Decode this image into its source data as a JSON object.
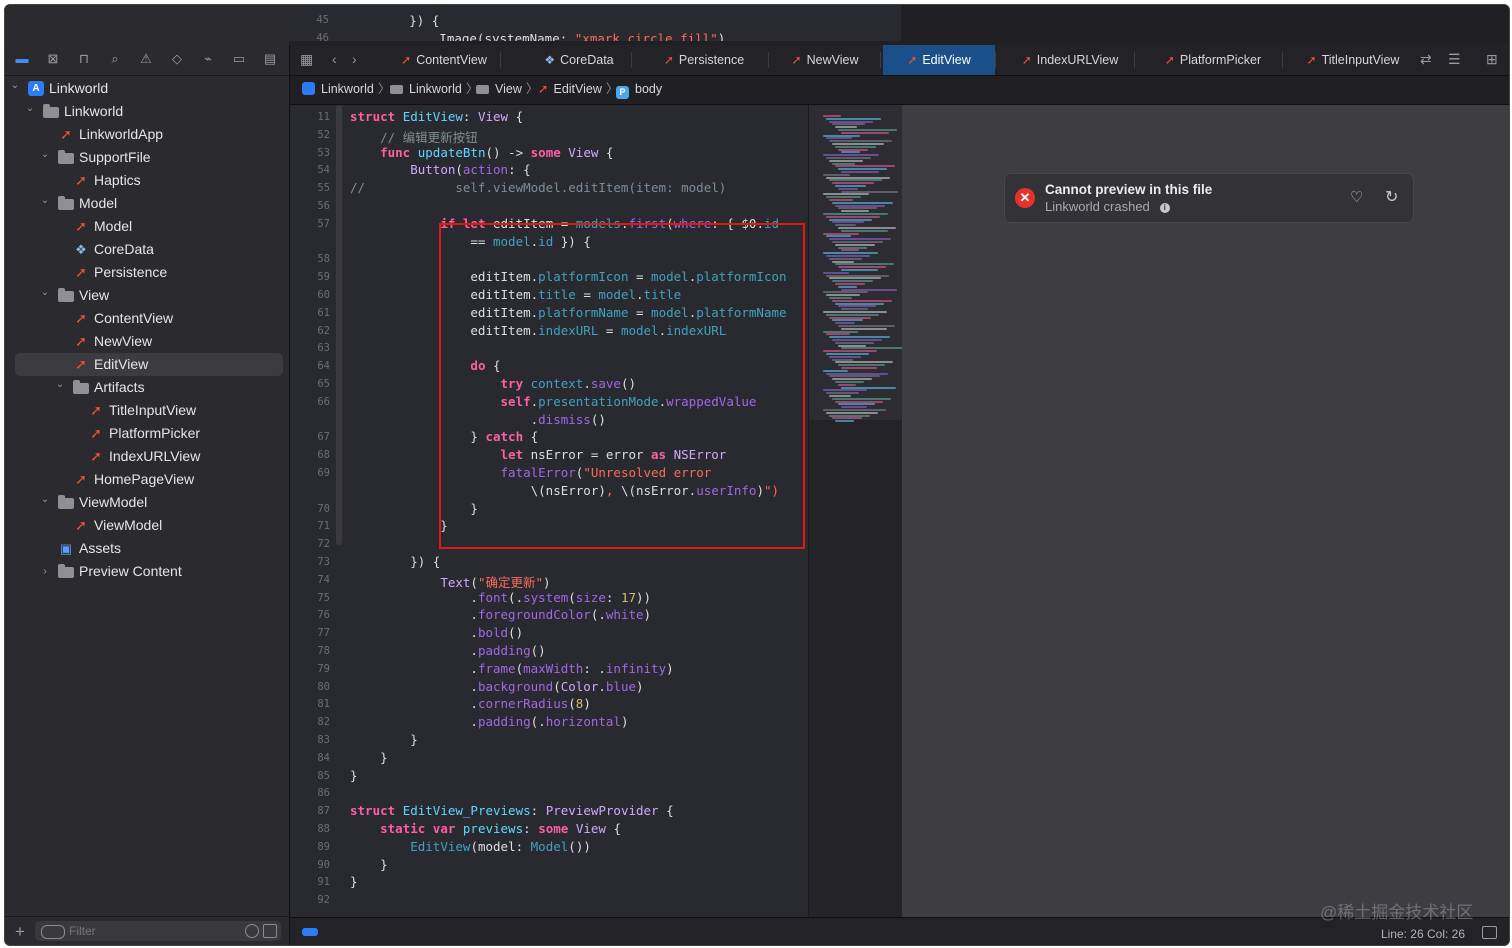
{
  "top_code": {
    "lines": [
      {
        "n": "45",
        "t": "        }) {"
      },
      {
        "n": "46",
        "t": "            Image(systemName: \"xmark.circle.fill\")"
      }
    ]
  },
  "navigator": {
    "toolbar_icons": [
      "folder-icon",
      "source-control-icon",
      "symbol-icon",
      "find-icon",
      "issue-icon",
      "test-icon",
      "debug-icon",
      "breakpoint-icon",
      "report-icon"
    ],
    "tree": [
      {
        "label": "Linkworld",
        "icon": "project",
        "depth": 0,
        "disc": "open"
      },
      {
        "label": "Linkworld",
        "icon": "folder",
        "depth": 1,
        "disc": "open"
      },
      {
        "label": "LinkworldApp",
        "icon": "swift",
        "depth": 2,
        "disc": ""
      },
      {
        "label": "SupportFile",
        "icon": "folder",
        "depth": 2,
        "disc": "open"
      },
      {
        "label": "Haptics",
        "icon": "swift",
        "depth": 3,
        "disc": ""
      },
      {
        "label": "Model",
        "icon": "folder",
        "depth": 2,
        "disc": "open"
      },
      {
        "label": "Model",
        "icon": "swift",
        "depth": 3,
        "disc": ""
      },
      {
        "label": "CoreData",
        "icon": "coredata",
        "depth": 3,
        "disc": ""
      },
      {
        "label": "Persistence",
        "icon": "swift",
        "depth": 3,
        "disc": ""
      },
      {
        "label": "View",
        "icon": "folder",
        "depth": 2,
        "disc": "open"
      },
      {
        "label": "ContentView",
        "icon": "swift",
        "depth": 3,
        "disc": ""
      },
      {
        "label": "NewView",
        "icon": "swift",
        "depth": 3,
        "disc": ""
      },
      {
        "label": "EditView",
        "icon": "swift",
        "depth": 3,
        "disc": "",
        "selected": true
      },
      {
        "label": "Artifacts",
        "icon": "folder",
        "depth": 3,
        "disc": "open"
      },
      {
        "label": "TitleInputView",
        "icon": "swift",
        "depth": 4,
        "disc": ""
      },
      {
        "label": "PlatformPicker",
        "icon": "swift",
        "depth": 4,
        "disc": ""
      },
      {
        "label": "IndexURLView",
        "icon": "swift",
        "depth": 4,
        "disc": ""
      },
      {
        "label": "HomePageView",
        "icon": "swift",
        "depth": 3,
        "disc": ""
      },
      {
        "label": "ViewModel",
        "icon": "folder",
        "depth": 2,
        "disc": "open"
      },
      {
        "label": "ViewModel",
        "icon": "swift",
        "depth": 3,
        "disc": ""
      },
      {
        "label": "Assets",
        "icon": "assets",
        "depth": 2,
        "disc": ""
      },
      {
        "label": "Preview Content",
        "icon": "folder",
        "depth": 2,
        "disc": "closed"
      }
    ],
    "filter_placeholder": "Filter"
  },
  "tabs": [
    {
      "label": "ContentView",
      "icon": "swift"
    },
    {
      "label": "CoreData",
      "icon": "coredata"
    },
    {
      "label": "Persistence",
      "icon": "swift"
    },
    {
      "label": "NewView",
      "icon": "swift"
    },
    {
      "label": "EditView",
      "icon": "swift",
      "active": true
    },
    {
      "label": "IndexURLView",
      "icon": "swift"
    },
    {
      "label": "PlatformPicker",
      "icon": "swift"
    },
    {
      "label": "TitleInputView",
      "icon": "swift"
    }
  ],
  "breadcrumb": [
    "Linkworld",
    "Linkworld",
    "View",
    "EditView",
    "body"
  ],
  "code_lines": [
    {
      "n": "11",
      "h": "<span class='kw'>struct</span> <span class='ty'>EditView</span>: <span class='ty2'>View</span> {"
    },
    {
      "n": "52",
      "h": "    <span class='cm'>// 编辑更新按钮</span>"
    },
    {
      "n": "53",
      "h": "    <span class='kw'>func</span> <span class='ty'>updateBtn</span>() -> <span class='kw'>some</span> <span class='ty2'>View</span> {"
    },
    {
      "n": "54",
      "h": "        <span class='ty2'>Button</span>(<span class='me'>action</span>: {"
    },
    {
      "n": "55",
      "h": "<span class='cm'>//            self.viewModel.editItem(item: model)</span>"
    },
    {
      "n": "56",
      "h": ""
    },
    {
      "n": "57",
      "h": "            <span class='kw'>if</span> <span class='kw'>let</span> editItem = <span class='ref'>models</span>.<span class='me'>first</span>(<span class='me'>where</span>: { $0.<span class='ref'>id</span>"
    },
    {
      "n": "",
      "h": "                == <span class='ref'>model</span>.<span class='ref'>id</span> }) {"
    },
    {
      "n": "58",
      "h": ""
    },
    {
      "n": "59",
      "h": "                editItem.<span class='ref'>platformIcon</span> = <span class='ref'>model</span>.<span class='ref'>platformIcon</span>"
    },
    {
      "n": "60",
      "h": "                editItem.<span class='ref'>title</span> = <span class='ref'>model</span>.<span class='ref'>title</span>"
    },
    {
      "n": "61",
      "h": "                editItem.<span class='ref'>platformName</span> = <span class='ref'>model</span>.<span class='ref'>platformName</span>"
    },
    {
      "n": "62",
      "h": "                editItem.<span class='ref'>indexURL</span> = <span class='ref'>model</span>.<span class='ref'>indexURL</span>"
    },
    {
      "n": "63",
      "h": ""
    },
    {
      "n": "64",
      "h": "                <span class='kw'>do</span> {"
    },
    {
      "n": "65",
      "h": "                    <span class='kw'>try</span> <span class='ref'>context</span>.<span class='me'>save</span>()"
    },
    {
      "n": "66",
      "h": "                    <span class='kw'>self</span>.<span class='ref'>presentationMode</span>.<span class='me'>wrappedValue</span>"
    },
    {
      "n": "",
      "h": "                        .<span class='me'>dismiss</span>()"
    },
    {
      "n": "67",
      "h": "                } <span class='kw'>catch</span> {"
    },
    {
      "n": "68",
      "h": "                    <span class='kw'>let</span> nsError = error <span class='kw'>as</span> <span class='ty2'>NSError</span>"
    },
    {
      "n": "69",
      "h": "                    <span class='me'>fatalError</span>(<span class='str'>\"Unresolved error</span>"
    },
    {
      "n": "",
      "h": "<span class='str'>                        </span>\\(nsError)<span class='str'>, </span>\\(nsError.<span class='me'>userInfo</span>)<span class='str'>\")</span>"
    },
    {
      "n": "70",
      "h": "                }"
    },
    {
      "n": "71",
      "h": "            }"
    },
    {
      "n": "72",
      "h": ""
    },
    {
      "n": "73",
      "h": "        }) {"
    },
    {
      "n": "74",
      "h": "            <span class='ty2'>Text</span>(<span class='str'>\"确定更新\"</span>)"
    },
    {
      "n": "75",
      "h": "                .<span class='me'>font</span>(.<span class='me'>system</span>(<span class='me'>size</span>: <span class='num'>17</span>))"
    },
    {
      "n": "76",
      "h": "                .<span class='me'>foregroundColor</span>(.<span class='me'>white</span>)"
    },
    {
      "n": "77",
      "h": "                .<span class='me'>bold</span>()"
    },
    {
      "n": "78",
      "h": "                .<span class='me'>padding</span>()"
    },
    {
      "n": "79",
      "h": "                .<span class='me'>frame</span>(<span class='me'>maxWidth</span>: .<span class='me'>infinity</span>)"
    },
    {
      "n": "80",
      "h": "                .<span class='me'>background</span>(<span class='ty2'>Color</span>.<span class='me'>blue</span>)"
    },
    {
      "n": "81",
      "h": "                .<span class='me'>cornerRadius</span>(<span class='num'>8</span>)"
    },
    {
      "n": "82",
      "h": "                .<span class='me'>padding</span>(.<span class='me'>horizontal</span>)"
    },
    {
      "n": "83",
      "h": "        }"
    },
    {
      "n": "84",
      "h": "    }"
    },
    {
      "n": "85",
      "h": "}"
    },
    {
      "n": "86",
      "h": ""
    },
    {
      "n": "87",
      "h": "<span class='kw'>struct</span> <span class='ty'>EditView_Previews</span>: <span class='ty2'>PreviewProvider</span> {"
    },
    {
      "n": "88",
      "h": "    <span class='kw'>static</span> <span class='kw'>var</span> <span class='ty'>previews</span>: <span class='kw'>some</span> <span class='ty2'>View</span> {"
    },
    {
      "n": "89",
      "h": "        <span class='ref'>EditView</span>(model: <span class='ref'>Model</span>())"
    },
    {
      "n": "90",
      "h": "    }"
    },
    {
      "n": "91",
      "h": "}"
    },
    {
      "n": "92",
      "h": ""
    }
  ],
  "preview": {
    "title": "Cannot preview in this file",
    "subtitle": "Linkworld crashed"
  },
  "status": {
    "position": "Line: 26  Col: 26"
  },
  "watermark": "@稀土掘金技术社区"
}
